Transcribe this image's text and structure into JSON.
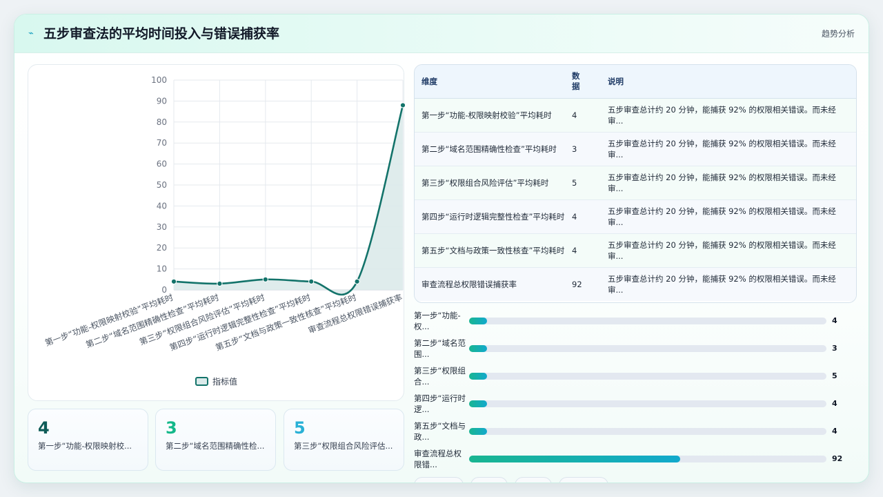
{
  "header": {
    "title": "五步审查法的平均时间投入与错误捕获率",
    "link": "趋势分析",
    "icon": "trend-icon"
  },
  "chart_data": {
    "type": "line",
    "categories": [
      "第一步“功能-权限映射校验”平均耗时",
      "第二步“域名范围精确性检查”平均耗时",
      "第三步“权限组合风险评估”平均耗时",
      "第四步“运行时逻辑完整性检查”平均耗时",
      "第五步“文档与政策一致性核查”平均耗时",
      "审查流程总权限错误捕获率"
    ],
    "series": [
      {
        "name": "指标值",
        "values": [
          4,
          3,
          5,
          4,
          4,
          88
        ]
      }
    ],
    "ylim": [
      0,
      100
    ],
    "yticks": [
      "0",
      "10",
      "20",
      "30",
      "40",
      "50",
      "60",
      "70",
      "80",
      "90",
      "100"
    ],
    "grid": true,
    "legend": "bottom",
    "colors": {
      "line": "#13736a",
      "area": "#dbeaea"
    }
  },
  "kpis": [
    {
      "value": "4",
      "label": "第一步“功能-权限映射校...",
      "color": "#0f5c58"
    },
    {
      "value": "3",
      "label": "第二步“域名范围精确性检...",
      "color": "#14b88a"
    },
    {
      "value": "5",
      "label": "第三步“权限组合风险评估...",
      "color": "#2ab1d6"
    }
  ],
  "table": {
    "headers": [
      "维度",
      "数据",
      "说明"
    ],
    "rows": [
      {
        "dim": "第一步“功能-权限映射校验”平均耗时",
        "val": "4",
        "desc": "五步审查总计约 20 分钟，能捕获 92% 的权限相关错误。而未经审..."
      },
      {
        "dim": "第二步“域名范围精确性检查”平均耗时",
        "val": "3",
        "desc": "五步审查总计约 20 分钟，能捕获 92% 的权限相关错误。而未经审..."
      },
      {
        "dim": "第三步“权限组合风险评估”平均耗时",
        "val": "5",
        "desc": "五步审查总计约 20 分钟，能捕获 92% 的权限相关错误。而未经审..."
      },
      {
        "dim": "第四步“运行时逻辑完整性检查”平均耗时",
        "val": "4",
        "desc": "五步审查总计约 20 分钟，能捕获 92% 的权限相关错误。而未经审..."
      },
      {
        "dim": "第五步“文档与政策一致性核查”平均耗时",
        "val": "4",
        "desc": "五步审查总计约 20 分钟，能捕获 92% 的权限相关错误。而未经审..."
      },
      {
        "dim": "审查流程总权限错误捕获率",
        "val": "92",
        "desc": "五步审查总计约 20 分钟，能捕获 92% 的权限相关错误。而未经审..."
      }
    ]
  },
  "bars": [
    {
      "label": "第一步“功能-权...",
      "value": "4",
      "pct": 0.05
    },
    {
      "label": "第二步“域名范围...",
      "value": "3",
      "pct": 0.05
    },
    {
      "label": "第三步“权限组合...",
      "value": "5",
      "pct": 0.05
    },
    {
      "label": "第四步“运行时逻...",
      "value": "4",
      "pct": 0.05
    },
    {
      "label": "第五步“文档与政...",
      "value": "4",
      "pct": 0.05
    },
    {
      "label": "审查流程总权限错...",
      "value": "92",
      "pct": 0.59
    }
  ]
}
